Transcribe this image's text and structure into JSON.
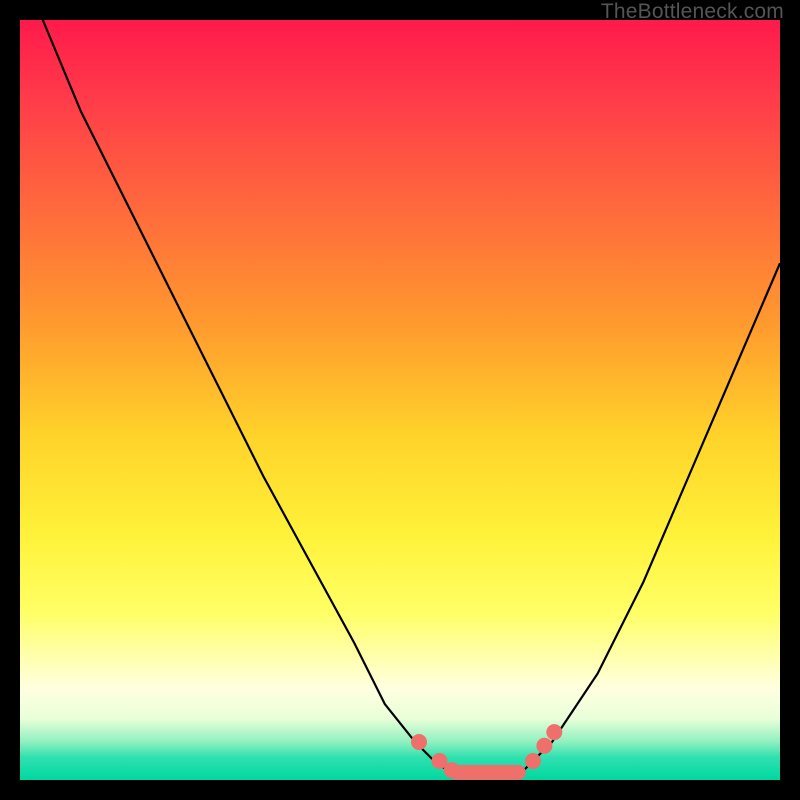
{
  "watermark": {
    "text": "TheBottleneck.com"
  },
  "chart_data": {
    "type": "line",
    "title": "",
    "xlabel": "",
    "ylabel": "",
    "xlim": [
      0,
      100
    ],
    "ylim": [
      0,
      100
    ],
    "grid": false,
    "legend": false,
    "series": [
      {
        "name": "left-curve",
        "x": [
          3,
          8,
          14,
          20,
          26,
          32,
          38,
          44,
          48,
          52,
          55,
          57
        ],
        "y": [
          100,
          88,
          76,
          64,
          52,
          40,
          29,
          18,
          10,
          5,
          2,
          1
        ]
      },
      {
        "name": "flat-bottom",
        "x": [
          57,
          60,
          63,
          66
        ],
        "y": [
          1,
          1,
          1,
          1
        ]
      },
      {
        "name": "right-curve",
        "x": [
          66,
          70,
          76,
          82,
          88,
          94,
          100
        ],
        "y": [
          1,
          5,
          14,
          26,
          40,
          54,
          68
        ]
      }
    ],
    "markers": [
      {
        "name": "left-dots",
        "x": [
          52.5,
          55.2,
          56.8
        ],
        "y": [
          5.0,
          2.5,
          1.3
        ]
      },
      {
        "name": "bottom-capsule",
        "x": [
          57.5,
          59.5,
          61.5,
          63.5,
          65.5
        ],
        "y": [
          1.0,
          1.0,
          1.0,
          1.0,
          1.0
        ]
      },
      {
        "name": "right-dots",
        "x": [
          67.5,
          69.0,
          70.3
        ],
        "y": [
          2.5,
          4.5,
          6.3
        ]
      }
    ],
    "colors": {
      "curve": "#000000",
      "marker": "#ef6f6a"
    }
  }
}
